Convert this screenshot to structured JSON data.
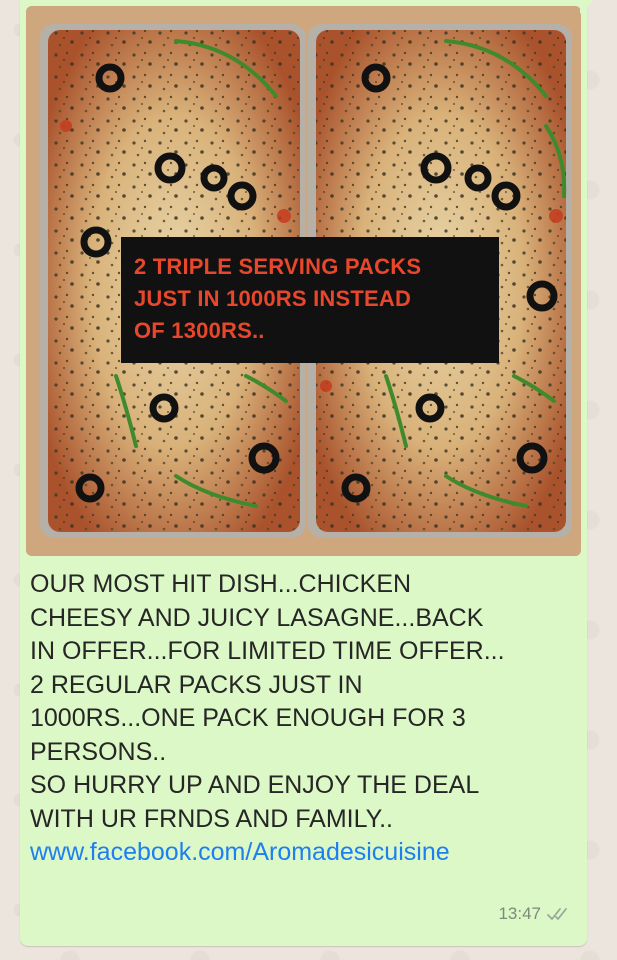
{
  "message": {
    "overlay_lines": [
      "2 TRIPLE SERVING PACKS",
      "JUST IN 1000RS INSTEAD",
      "OF 1300RS.."
    ],
    "caption_lines": [
      "OUR MOST HIT DISH...CHICKEN",
      "CHEESY AND JUICY LASAGNE...BACK",
      "IN OFFER...FOR LIMITED TIME OFFER...",
      "2 REGULAR PACKS JUST IN",
      "1000RS...ONE PACK ENOUGH FOR 3",
      "PERSONS..",
      "SO HURRY UP AND ENJOY THE DEAL",
      "WITH UR FRNDS AND FAMILY.."
    ],
    "link_text": "www.facebook.com/Aromadesicuisine",
    "time": "13:47",
    "status_icon": "double-check-icon"
  },
  "colors": {
    "bubble": "#dcf8c6",
    "overlay_text": "#e8472c",
    "link": "#1d7ff0"
  }
}
